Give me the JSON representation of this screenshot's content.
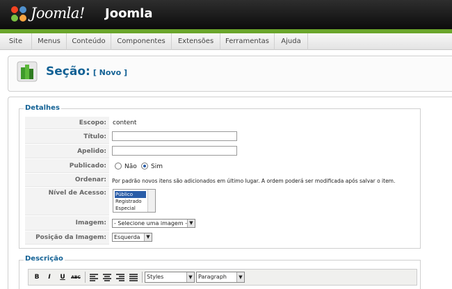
{
  "header": {
    "brand": "Joomla!",
    "title": "Joomla"
  },
  "menu": [
    "Site",
    "Menus",
    "Conteúdo",
    "Componentes",
    "Extensões",
    "Ferramentas",
    "Ajuda"
  ],
  "page": {
    "title": "Seção:",
    "subtitle": "[ Novo ]"
  },
  "details": {
    "legend": "Detalhes",
    "scope_label": "Escopo:",
    "scope_value": "content",
    "title_label": "Título:",
    "alias_label": "Apelido:",
    "published_label": "Publicado:",
    "published_no": "Não",
    "published_yes": "Sim",
    "order_label": "Ordenar:",
    "order_text": "Por padrão novos itens são adicionados em último lugar. A ordem poderá ser modificada após salvar o item.",
    "access_label": "Nível de Acesso:",
    "access_options": [
      "Público",
      "Registrado",
      "Especial"
    ],
    "image_label": "Imagem:",
    "image_value": "- Selecione uma imagem -",
    "image_pos_label": "Posição da Imagem:",
    "image_pos_value": "Esquerda"
  },
  "description": {
    "legend": "Descrição",
    "styles": "Styles",
    "paragraph": "Paragraph",
    "buttons": [
      "B",
      "I",
      "U",
      "ABC"
    ]
  }
}
